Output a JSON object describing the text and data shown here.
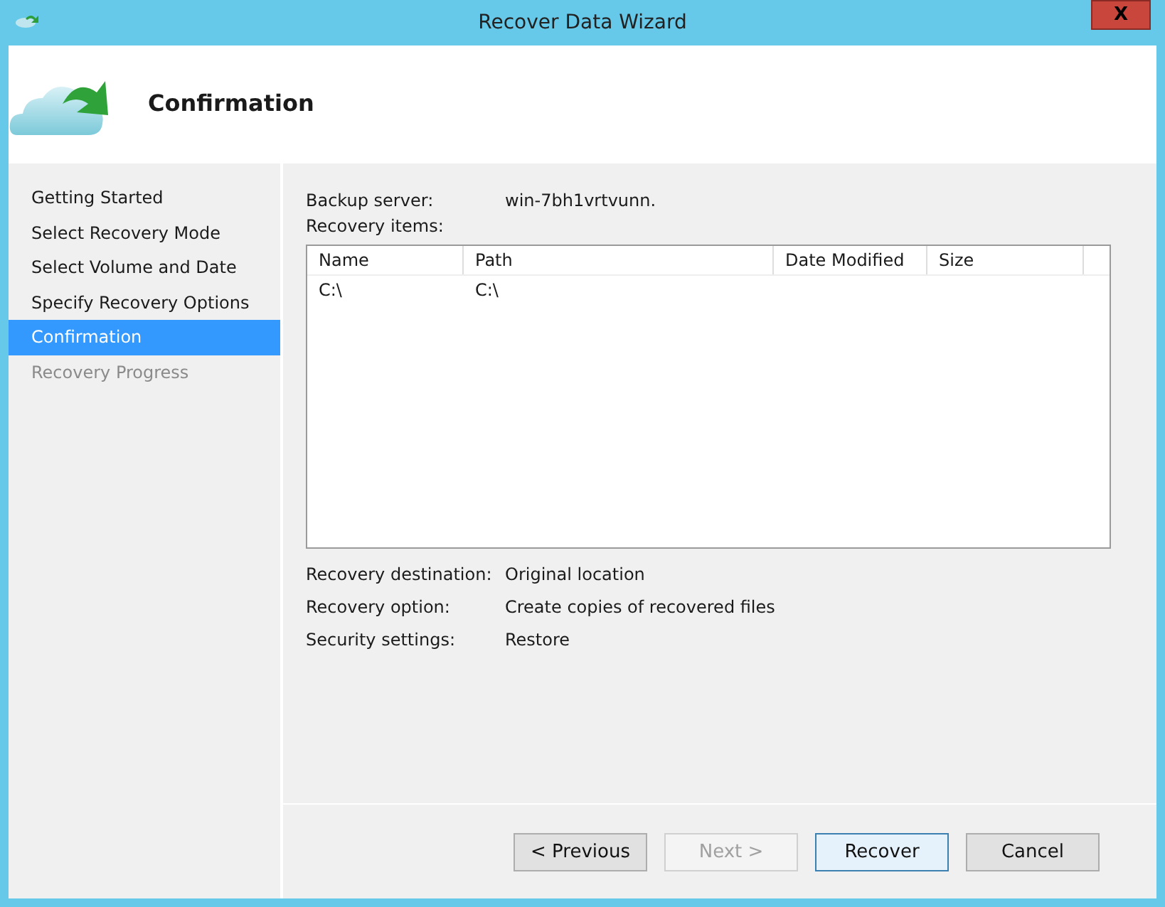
{
  "window": {
    "title": "Recover Data Wizard",
    "close_label": "X"
  },
  "header": {
    "title": "Confirmation"
  },
  "steps": [
    {
      "label": "Getting Started",
      "selected": false,
      "disabled": false
    },
    {
      "label": "Select Recovery Mode",
      "selected": false,
      "disabled": false
    },
    {
      "label": "Select Volume and Date",
      "selected": false,
      "disabled": false
    },
    {
      "label": "Specify Recovery Options",
      "selected": false,
      "disabled": false
    },
    {
      "label": "Confirmation",
      "selected": true,
      "disabled": false
    },
    {
      "label": "Recovery Progress",
      "selected": false,
      "disabled": true
    }
  ],
  "backup_server": {
    "label": "Backup server:",
    "value": "win-7bh1vrtvunn."
  },
  "recovery_items": {
    "label": "Recovery items:",
    "columns": [
      "Name",
      "Path",
      "Date Modified",
      "Size"
    ],
    "rows": [
      [
        "C:\\",
        "C:\\"
      ]
    ]
  },
  "summary": [
    {
      "label": "Recovery destination:",
      "value": "Original location"
    },
    {
      "label": "Recovery option:",
      "value": "Create copies of recovered files"
    },
    {
      "label": "Security settings:",
      "value": "Restore"
    }
  ],
  "buttons": [
    {
      "label": "< Previous",
      "disabled": false,
      "default": false
    },
    {
      "label": "Next >",
      "disabled": true,
      "default": false
    },
    {
      "label": "Recover",
      "disabled": false,
      "default": true
    },
    {
      "label": "Cancel",
      "disabled": false,
      "default": false
    }
  ]
}
